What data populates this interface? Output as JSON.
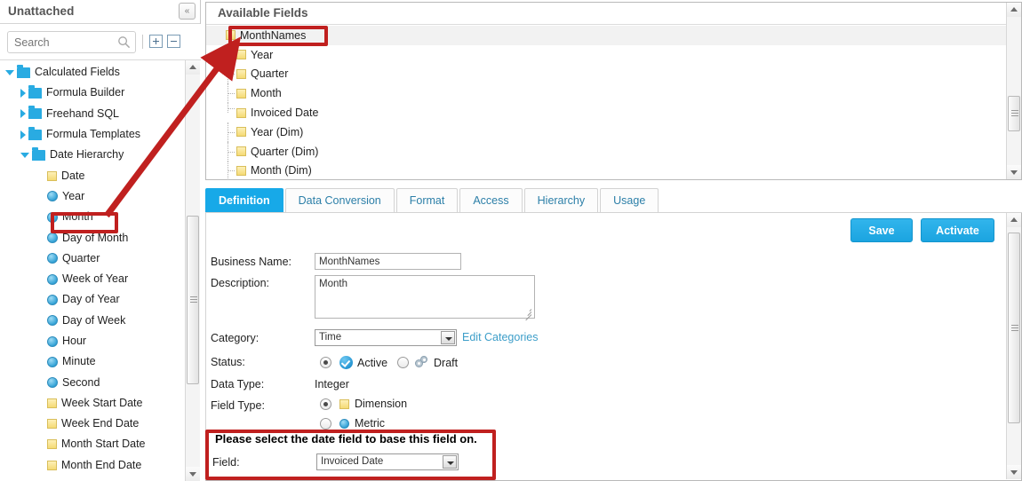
{
  "left_panel": {
    "title": "Unattached",
    "collapse_icon": "double-chevron-left-icon",
    "search": {
      "placeholder": "Search",
      "value": "",
      "icon": "search-icon",
      "expand_all_icon": "expand-all-icon",
      "collapse_all_icon": "collapse-all-icon"
    },
    "tree": [
      {
        "label": "Calculated Fields",
        "indent": 0,
        "twisty": "open",
        "icon": "folder-icon"
      },
      {
        "label": "Formula Builder",
        "indent": 1,
        "twisty": "closed",
        "icon": "folder-icon"
      },
      {
        "label": "Freehand SQL",
        "indent": 1,
        "twisty": "closed",
        "icon": "folder-icon"
      },
      {
        "label": "Formula Templates",
        "indent": 1,
        "twisty": "closed",
        "icon": "folder-icon"
      },
      {
        "label": "Date Hierarchy",
        "indent": 1,
        "twisty": "open",
        "icon": "folder-icon"
      },
      {
        "label": "Date",
        "indent": 2,
        "twisty": "none",
        "icon": "yellow-square-icon"
      },
      {
        "label": "Year",
        "indent": 2,
        "twisty": "none",
        "icon": "blue-circle-icon"
      },
      {
        "label": "Month",
        "indent": 2,
        "twisty": "none",
        "icon": "blue-circle-icon"
      },
      {
        "label": "Day of Month",
        "indent": 2,
        "twisty": "none",
        "icon": "blue-circle-icon"
      },
      {
        "label": "Quarter",
        "indent": 2,
        "twisty": "none",
        "icon": "blue-circle-icon"
      },
      {
        "label": "Week of Year",
        "indent": 2,
        "twisty": "none",
        "icon": "blue-circle-icon"
      },
      {
        "label": "Day of Year",
        "indent": 2,
        "twisty": "none",
        "icon": "blue-circle-icon"
      },
      {
        "label": "Day of Week",
        "indent": 2,
        "twisty": "none",
        "icon": "blue-circle-icon"
      },
      {
        "label": "Hour",
        "indent": 2,
        "twisty": "none",
        "icon": "blue-circle-icon"
      },
      {
        "label": "Minute",
        "indent": 2,
        "twisty": "none",
        "icon": "blue-circle-icon"
      },
      {
        "label": "Second",
        "indent": 2,
        "twisty": "none",
        "icon": "blue-circle-icon"
      },
      {
        "label": "Week Start Date",
        "indent": 2,
        "twisty": "none",
        "icon": "yellow-square-icon"
      },
      {
        "label": "Week End Date",
        "indent": 2,
        "twisty": "none",
        "icon": "yellow-square-icon"
      },
      {
        "label": "Month Start Date",
        "indent": 2,
        "twisty": "none",
        "icon": "yellow-square-icon"
      },
      {
        "label": "Month End Date",
        "indent": 2,
        "twisty": "none",
        "icon": "yellow-square-icon"
      }
    ]
  },
  "available_fields": {
    "title": "Available Fields",
    "items": [
      {
        "label": "MonthNames",
        "root": true,
        "selected": true,
        "last": false
      },
      {
        "label": "Year",
        "root": false,
        "selected": false,
        "last": false
      },
      {
        "label": "Quarter",
        "root": false,
        "selected": false,
        "last": false
      },
      {
        "label": "Month",
        "root": false,
        "selected": false,
        "last": false
      },
      {
        "label": "Invoiced Date",
        "root": false,
        "selected": false,
        "last": true
      },
      {
        "label": "Year (Dim)",
        "root": false,
        "selected": false,
        "last": false
      },
      {
        "label": "Quarter (Dim)",
        "root": false,
        "selected": false,
        "last": false
      },
      {
        "label": "Month (Dim)",
        "root": false,
        "selected": false,
        "last": false
      }
    ]
  },
  "tabs": [
    {
      "label": "Definition",
      "active": true
    },
    {
      "label": "Data Conversion",
      "active": false
    },
    {
      "label": "Format",
      "active": false
    },
    {
      "label": "Access",
      "active": false
    },
    {
      "label": "Hierarchy",
      "active": false
    },
    {
      "label": "Usage",
      "active": false
    }
  ],
  "definition": {
    "save_label": "Save",
    "activate_label": "Activate",
    "business_name": {
      "label": "Business Name:",
      "value": "MonthNames"
    },
    "description": {
      "label": "Description:",
      "value": "Month"
    },
    "category": {
      "label": "Category:",
      "value": "Time",
      "edit_link": "Edit Categories"
    },
    "status": {
      "label": "Status:",
      "active_label": "Active",
      "draft_label": "Draft",
      "selected": "Active",
      "active_icon": "blue-check-circle-icon",
      "draft_icon": "gears-icon"
    },
    "data_type": {
      "label": "Data Type:",
      "value": "Integer"
    },
    "field_type": {
      "label": "Field Type:",
      "dimension_label": "Dimension",
      "metric_label": "Metric",
      "selected": "Dimension",
      "dimension_icon": "yellow-square-icon",
      "metric_icon": "blue-circle-icon"
    },
    "date_base": {
      "message": "Please select the date field to base this field on.",
      "field_label": "Field:",
      "field_value": "Invoiced Date"
    }
  },
  "annotations": {
    "highlight_color": "#c0201f",
    "arrow_from": "Month (left tree)",
    "arrow_to": "MonthNames (available fields)"
  },
  "colors": {
    "accent_blue": "#17a9e8",
    "link_blue": "#3d9ec9",
    "folder_blue": "#29abe2",
    "annotation_red": "#c0201f",
    "yellow_icon": "#f5da74"
  }
}
